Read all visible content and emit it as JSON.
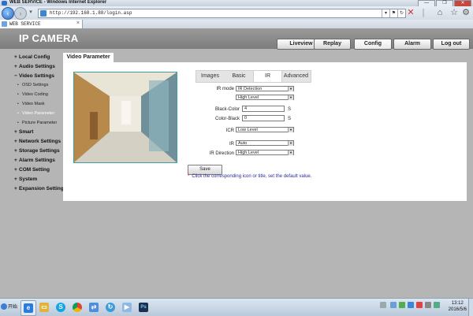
{
  "browser": {
    "title": "WEB SERVICE - Windows Internet Explorer",
    "url": "http://192.168.1.88/login.asp",
    "tab_title": "WEB SERVICE",
    "window_controls": [
      "—",
      "❐",
      "✕"
    ]
  },
  "header": {
    "brand": "IP CAMERA",
    "nav": [
      "Liveview",
      "Replay",
      "Config",
      "Alarm",
      "Log out"
    ],
    "active_nav": "Config"
  },
  "sidebar": {
    "items": [
      {
        "sign": "+",
        "label": "Local Config"
      },
      {
        "sign": "+",
        "label": "Audio Settings"
      },
      {
        "sign": "−",
        "label": "Video Settings"
      },
      {
        "sign": "+",
        "label": "Smart"
      },
      {
        "sign": "+",
        "label": "Network Settings"
      },
      {
        "sign": "+",
        "label": "Storage Settings"
      },
      {
        "sign": "+",
        "label": "Alarm Settings"
      },
      {
        "sign": "+",
        "label": "COM Setting"
      },
      {
        "sign": "+",
        "label": "System"
      },
      {
        "sign": "+",
        "label": "Expansion Settings"
      }
    ],
    "video_sub": [
      "OSD Settings",
      "Video Coding",
      "Video Mask",
      "Video Parameter",
      "Picture Parameter"
    ],
    "active_sub": "Video Parameter"
  },
  "panel": {
    "title": "Video Parameter",
    "subtabs": [
      "Images",
      "Basic",
      "IR",
      "Advanced"
    ],
    "active_subtab": "IR",
    "form": {
      "ir_mode_label": "IR mode",
      "ir_mode_value": "IR Detection",
      "ir_level_value": "High Level",
      "black_color_label": "Black-Color",
      "black_color_value": "4",
      "color_black_label": "Color-Black",
      "color_black_value": "0",
      "unit": "S",
      "icr_label": "ICR",
      "icr_value": "Low Level",
      "ir_label": "IR",
      "ir_value": "Auto",
      "ir_direction_label": "IR Direction",
      "ir_direction_value": "High Level"
    },
    "save_label": "Save",
    "hint": "Click the corresponding icon or title, set the default value."
  },
  "taskbar": {
    "start_label": "开始",
    "apps": [
      "ie-icon",
      "folder-icon",
      "skype-icon",
      "chrome-icon",
      "network-icon",
      "update-icon",
      "media-icon",
      "photoshop-icon"
    ],
    "time": "13:12",
    "date": "2016/5/6"
  },
  "colors": {
    "header_bg": "#8a8a8a",
    "page_bg": "#b5b5b5",
    "accent_teal": "#3aa0a0"
  }
}
